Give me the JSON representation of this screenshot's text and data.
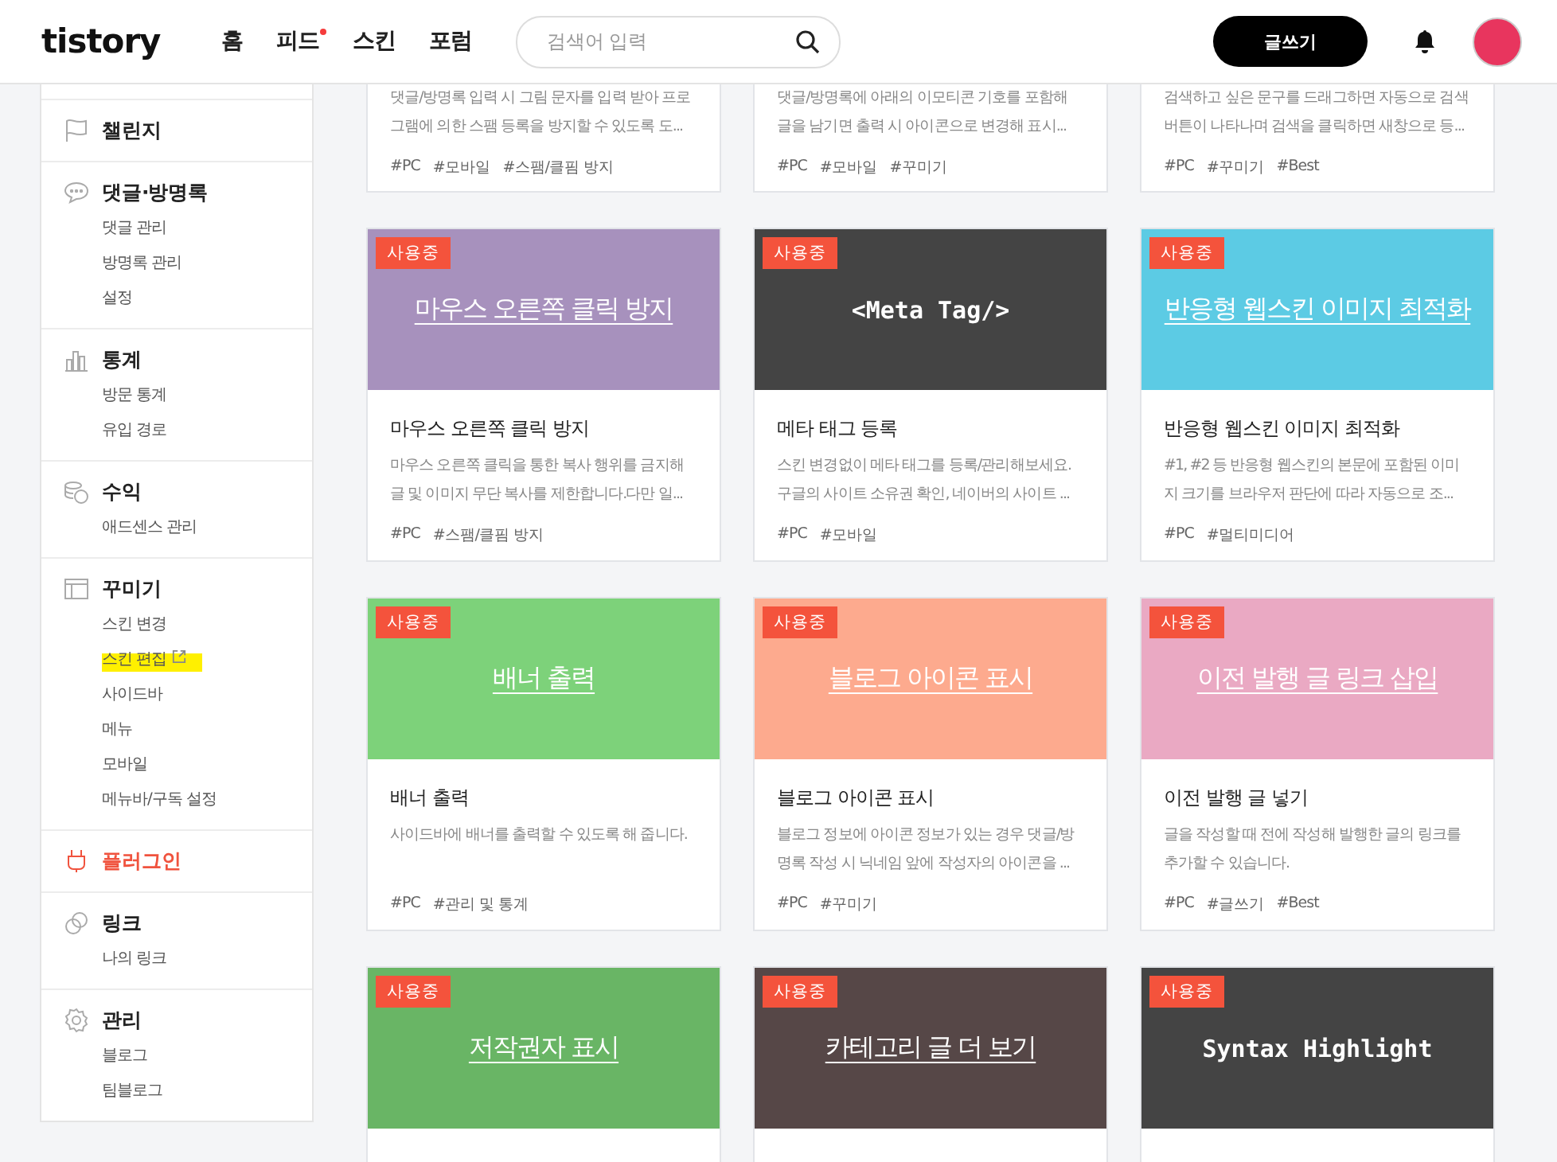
{
  "header": {
    "logo": "tistory",
    "nav": [
      {
        "label": "홈",
        "new_dot": false
      },
      {
        "label": "피드",
        "new_dot": true
      },
      {
        "label": "스킨",
        "new_dot": false
      },
      {
        "label": "포럼",
        "new_dot": false
      }
    ],
    "search": {
      "placeholder": "검색어 입력"
    },
    "write_button": "글쓰기"
  },
  "sidebar": {
    "sections": [
      {
        "kind": "flag",
        "title": "챌린지",
        "active": false
      },
      {
        "kind": "chat",
        "title": "댓글·방명록",
        "active": false,
        "items": [
          {
            "label": "댓글 관리",
            "highlighted": false,
            "external": false
          },
          {
            "label": "방명록 관리",
            "highlighted": false,
            "external": false
          },
          {
            "label": "설정",
            "highlighted": false,
            "external": false
          }
        ]
      },
      {
        "kind": "chart",
        "title": "통계",
        "active": false,
        "items": [
          {
            "label": "방문 통계",
            "highlighted": false,
            "external": false
          },
          {
            "label": "유입 경로",
            "highlighted": false,
            "external": false
          }
        ]
      },
      {
        "kind": "coins",
        "title": "수익",
        "active": false,
        "items": [
          {
            "label": "애드센스 관리",
            "highlighted": false,
            "external": false
          }
        ]
      },
      {
        "kind": "layout",
        "title": "꾸미기",
        "active": false,
        "items": [
          {
            "label": "스킨 변경",
            "highlighted": false,
            "external": false
          },
          {
            "label": "스킨 편집",
            "highlighted": true,
            "external": true
          },
          {
            "label": "사이드바",
            "highlighted": false,
            "external": false
          },
          {
            "label": "메뉴",
            "highlighted": false,
            "external": false
          },
          {
            "label": "모바일",
            "highlighted": false,
            "external": false
          },
          {
            "label": "메뉴바/구독 설정",
            "highlighted": false,
            "external": false
          }
        ]
      },
      {
        "kind": "plug",
        "title": "플러그인",
        "active": true
      },
      {
        "kind": "link",
        "title": "링크",
        "active": false,
        "items": [
          {
            "label": "나의 링크",
            "highlighted": false,
            "external": false
          }
        ]
      },
      {
        "kind": "gear",
        "title": "관리",
        "active": false,
        "items": [
          {
            "label": "블로그",
            "highlighted": false,
            "external": false
          },
          {
            "label": "팀블로그",
            "highlighted": false,
            "external": false
          }
        ]
      }
    ]
  },
  "cards": [
    {
      "kind": "partial",
      "description": "댓글/방명록 입력 시 그림 문자를 입력 받아 프로그램에 의한 스팸 등록을 방지할 수 있도록 도...",
      "tags": [
        "#PC",
        "#모바일",
        "#스팸/클핌 방지"
      ]
    },
    {
      "kind": "partial",
      "description": "댓글/방명록에 아래의 이모티콘 기호를 포함해 글을 남기면 출력 시 아이콘으로 변경해 표시...",
      "tags": [
        "#PC",
        "#모바일",
        "#꾸미기"
      ]
    },
    {
      "kind": "partial",
      "description": "검색하고 싶은 문구를 드래그하면 자동으로 검색 버튼이 나타나며 검색을 클릭하면 새창으로 등...",
      "tags": [
        "#PC",
        "#꾸미기",
        "#Best"
      ]
    },
    {
      "kind": "text",
      "badge": "사용중",
      "color": "#a791bd",
      "banner": "마우스 오른쪽 클릭 방지",
      "title": "마우스 오른쪽 클릭 방지",
      "description": "마우스 오른쪽 클릭을 통한 복사 행위를 금지해 글 및 이미지 무단 복사를 제한합니다.다만 일...",
      "tags": [
        "#PC",
        "#스팸/클핌 방지"
      ]
    },
    {
      "kind": "code",
      "badge": "사용중",
      "color": "#444444",
      "banner": "<Meta Tag/>",
      "title": "메타 태그 등록",
      "description": "스킨 변경없이 메타 태그를 등록/관리해보세요. 구글의 사이트 소유권 확인, 네이버의 사이트 ...",
      "tags": [
        "#PC",
        "#모바일"
      ]
    },
    {
      "kind": "text",
      "badge": "사용중",
      "color": "#5ccbe4",
      "banner": "반응형 웹스킨 이미지 최적화",
      "title": "반응형 웹스킨 이미지 최적화",
      "description": "#1, #2 등 반응형 웹스킨의 본문에 포함된 이미지 크기를 브라우저 판단에 따라 자동으로 조...",
      "tags": [
        "#PC",
        "#멀티미디어"
      ]
    },
    {
      "kind": "text",
      "badge": "사용중",
      "color": "#7dd27a",
      "banner": "배너 출력",
      "title": "배너 출력",
      "description": "사이드바에 배너를 출력할 수 있도록 해 줍니다.",
      "tags": [
        "#PC",
        "#관리 및 통계"
      ]
    },
    {
      "kind": "text",
      "badge": "사용중",
      "color": "#fdaa8e",
      "banner": "블로그 아이콘 표시",
      "title": "블로그 아이콘 표시",
      "description": "블로그 정보에 아이콘 정보가 있는 경우 댓글/방명록 작성 시 닉네임 앞에 작성자의 아이콘을 ...",
      "tags": [
        "#PC",
        "#꾸미기"
      ]
    },
    {
      "kind": "text",
      "badge": "사용중",
      "color": "#eaa9c3",
      "banner": "이전 발행 글 링크 삽입",
      "title": "이전 발행 글 넣기",
      "description": "글을 작성할 때 전에 작성해 발행한 글의 링크를 추가할 수 있습니다.",
      "tags": [
        "#PC",
        "#글쓰기",
        "#Best"
      ]
    },
    {
      "kind": "text",
      "badge": "사용중",
      "color": "#69b565",
      "banner": "저작권자 표시"
    },
    {
      "kind": "text",
      "badge": "사용중",
      "color": "#564747",
      "banner": "카테고리 글 더 보기"
    },
    {
      "kind": "code",
      "badge": "사용중",
      "color": "#444444",
      "banner": "Syntax Highlight"
    }
  ]
}
